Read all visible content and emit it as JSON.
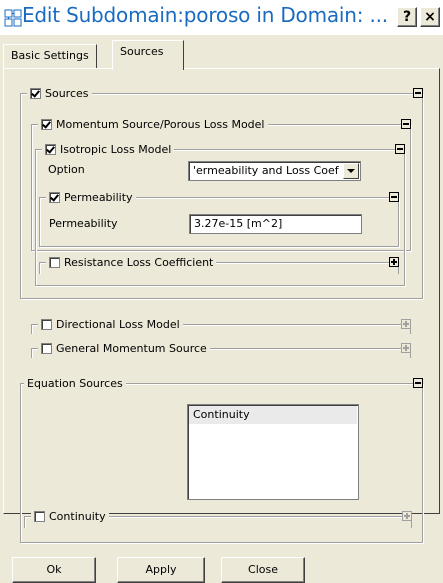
{
  "window": {
    "title": "Edit Subdomain:poroso in Domain: ...",
    "help_label": "?",
    "close_label": "×"
  },
  "tabs": [
    {
      "label": "Basic Settings",
      "active": false
    },
    {
      "label": "Sources",
      "active": true
    }
  ],
  "sources": {
    "label": "Sources",
    "checked": true,
    "momentum": {
      "label": "Momentum Source/Porous Loss Model",
      "checked": true,
      "isotropic": {
        "label": "Isotropic Loss Model",
        "checked": true,
        "option_label": "Option",
        "option_value": "'ermeability and Loss Coef",
        "permeability_group": {
          "label": "Permeability",
          "checked": true,
          "field_label": "Permeability",
          "field_value": "3.27e-15 [m^2]"
        },
        "resistance": {
          "label": "Resistance Loss Coefficient",
          "checked": false
        }
      },
      "directional": {
        "label": "Directional Loss Model",
        "checked": false
      },
      "general": {
        "label": "General Momentum Source",
        "checked": false
      }
    }
  },
  "equation_sources": {
    "label": "Equation Sources",
    "list_items": [
      "Continuity"
    ],
    "continuity": {
      "label": "Continuity",
      "checked": false
    }
  },
  "buttons": {
    "ok": "Ok",
    "apply": "Apply",
    "close": "Close"
  },
  "colors": {
    "title_text": "#1a6bc0",
    "dialog_bg": "#ece9d8"
  }
}
